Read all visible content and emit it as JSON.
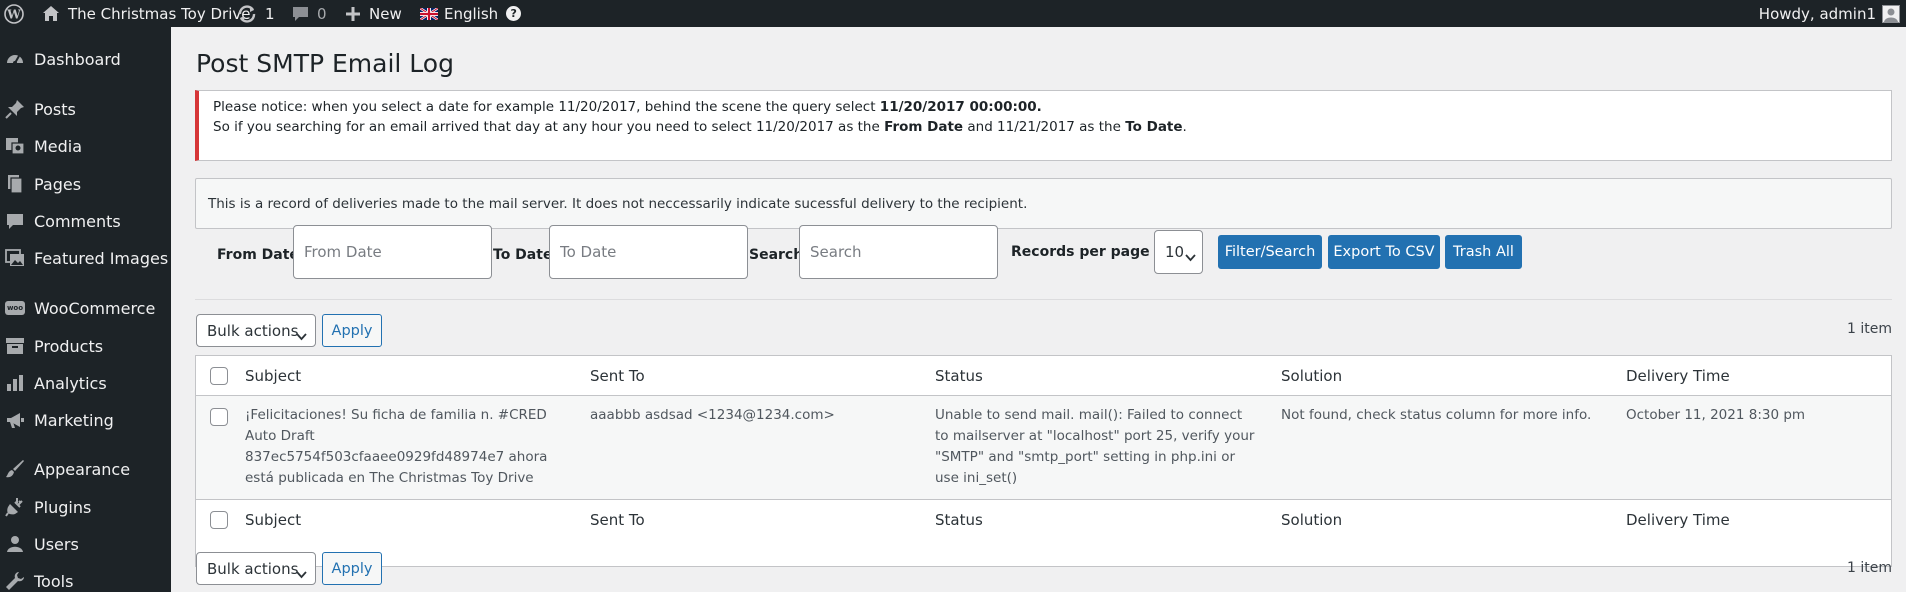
{
  "adminbar": {
    "site_name": "The Christmas Toy Drive",
    "updates_count": "1",
    "comments_count": "0",
    "new_label": "New",
    "language_label": "English",
    "help_label": "?",
    "howdy": "Howdy, admin1"
  },
  "sidebar": {
    "items": [
      {
        "label": "Dashboard",
        "icon": "dashboard-icon"
      },
      {
        "label": "Posts",
        "icon": "pin-icon"
      },
      {
        "label": "Media",
        "icon": "media-icon"
      },
      {
        "label": "Pages",
        "icon": "pages-icon"
      },
      {
        "label": "Comments",
        "icon": "comment-icon"
      },
      {
        "label": "Featured Images",
        "icon": "image-icon"
      },
      {
        "label": "WooCommerce",
        "icon": "woocommerce-icon"
      },
      {
        "label": "Products",
        "icon": "archive-icon"
      },
      {
        "label": "Analytics",
        "icon": "bar-chart-icon"
      },
      {
        "label": "Marketing",
        "icon": "megaphone-icon"
      },
      {
        "label": "Appearance",
        "icon": "brush-icon"
      },
      {
        "label": "Plugins",
        "icon": "plug-icon"
      },
      {
        "label": "Users",
        "icon": "user-icon"
      },
      {
        "label": "Tools",
        "icon": "wrench-icon"
      }
    ],
    "woo_badge": "woo"
  },
  "page": {
    "title": "Post SMTP Email Log",
    "notice": {
      "line1_a": "Please notice: when you select a date for example 11/20/2017, behind the scene the query select ",
      "line1_b": "11/20/2017 00:00:00.",
      "line2_a": "So if you searching for an email arrived that day at any hour you need to select 11/20/2017 as the ",
      "line2_b": "From Date",
      "line2_c": " and 11/21/2017 as the ",
      "line2_d": "To Date",
      "line2_e": "."
    },
    "info": "This is a record of deliveries made to the mail server. It does not neccessarily indicate sucessful delivery to the recipient."
  },
  "filters": {
    "from_label": "From Date",
    "from_placeholder": "From Date",
    "to_label": "To Date",
    "to_placeholder": "To Date",
    "search_label": "Search",
    "search_placeholder": "Search",
    "records_label": "Records per page",
    "records_value": "10",
    "filter_button": "Filter/Search",
    "export_button": "Export To CSV",
    "trash_button": "Trash All"
  },
  "bulk": {
    "label": "Bulk actions",
    "apply": "Apply",
    "count": "1 item"
  },
  "table": {
    "columns": [
      "Subject",
      "Sent To",
      "Status",
      "Solution",
      "Delivery Time"
    ],
    "rows": [
      {
        "subject": "¡Felicitaciones! Su ficha de familia n. #CRED Auto Draft 837ec5754f503cfaaee0929fd48974e7 ahora está publicada en The Christmas Toy Drive",
        "sent_to": "aaabbb asdsad <1234@1234.com>",
        "status": "Unable to send mail. mail(): Failed to connect to mailserver at \"localhost\" port 25, verify your \"SMTP\" and \"smtp_port\" setting in php.ini or use ini_set()",
        "solution": "Not found, check status column for more info.",
        "delivery_time": "October 11, 2021 8:30 pm"
      }
    ]
  },
  "colors": {
    "admin_dark": "#1d2327",
    "primary_blue": "#2271b1",
    "notice_red": "#d63638",
    "page_bg": "#f0f0f1"
  }
}
